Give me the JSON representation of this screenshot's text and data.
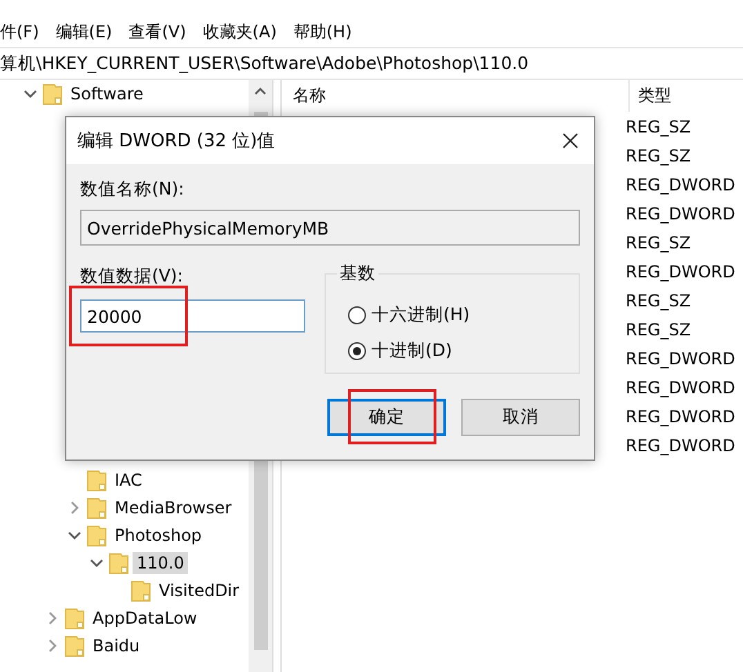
{
  "menu": [
    "件(F)",
    "编辑(E)",
    "查看(V)",
    "收藏夹(A)",
    "帮助(H)"
  ],
  "address": "算机\\HKEY_CURRENT_USER\\Software\\Adobe\\Photoshop\\110.0",
  "tree": [
    {
      "label": "Software",
      "expanded": true,
      "selected": false,
      "children": [
        {
          "children": [
            {
              "label": "IAC",
              "selected": false
            },
            {
              "label": "MediaBrowser",
              "expanded": false,
              "selected": false,
              "has_children": true
            },
            {
              "label": "Photoshop",
              "expanded": true,
              "selected": false,
              "children": [
                {
                  "label": "110.0",
                  "expanded": true,
                  "selected": true,
                  "children": [
                    {
                      "label": "VisitedDir",
                      "selected": false
                    }
                  ]
                }
              ]
            }
          ]
        },
        {
          "label": "AppDataLow",
          "expanded": false,
          "selected": false,
          "has_children": true
        },
        {
          "label": "Baidu",
          "expanded": false,
          "selected": false,
          "has_children": true
        }
      ]
    }
  ],
  "list": {
    "columns": [
      "名称",
      "类型"
    ],
    "types": [
      "REG_SZ",
      "REG_SZ",
      "REG_DWORD",
      "REG_DWORD",
      "REG_SZ",
      "REG_DWORD",
      "REG_SZ",
      "REG_SZ",
      "REG_DWORD",
      "REG_DWORD",
      "REG_DWORD",
      "REG_DWORD"
    ]
  },
  "dialog": {
    "title": "编辑 DWORD (32 位)值",
    "name_label": "数值名称(N):",
    "name_value": "OverridePhysicalMemoryMB",
    "data_label": "数值数据(V):",
    "data_value": "20000",
    "data_highlighted": true,
    "base_label": "基数",
    "radios": [
      {
        "label": "十六进制(H)",
        "selected": false
      },
      {
        "label": "十进制(D)",
        "selected": true
      }
    ],
    "buttons": [
      {
        "label": "确定",
        "default": true,
        "highlighted": true
      },
      {
        "label": "取消",
        "default": false,
        "highlighted": false
      }
    ]
  }
}
